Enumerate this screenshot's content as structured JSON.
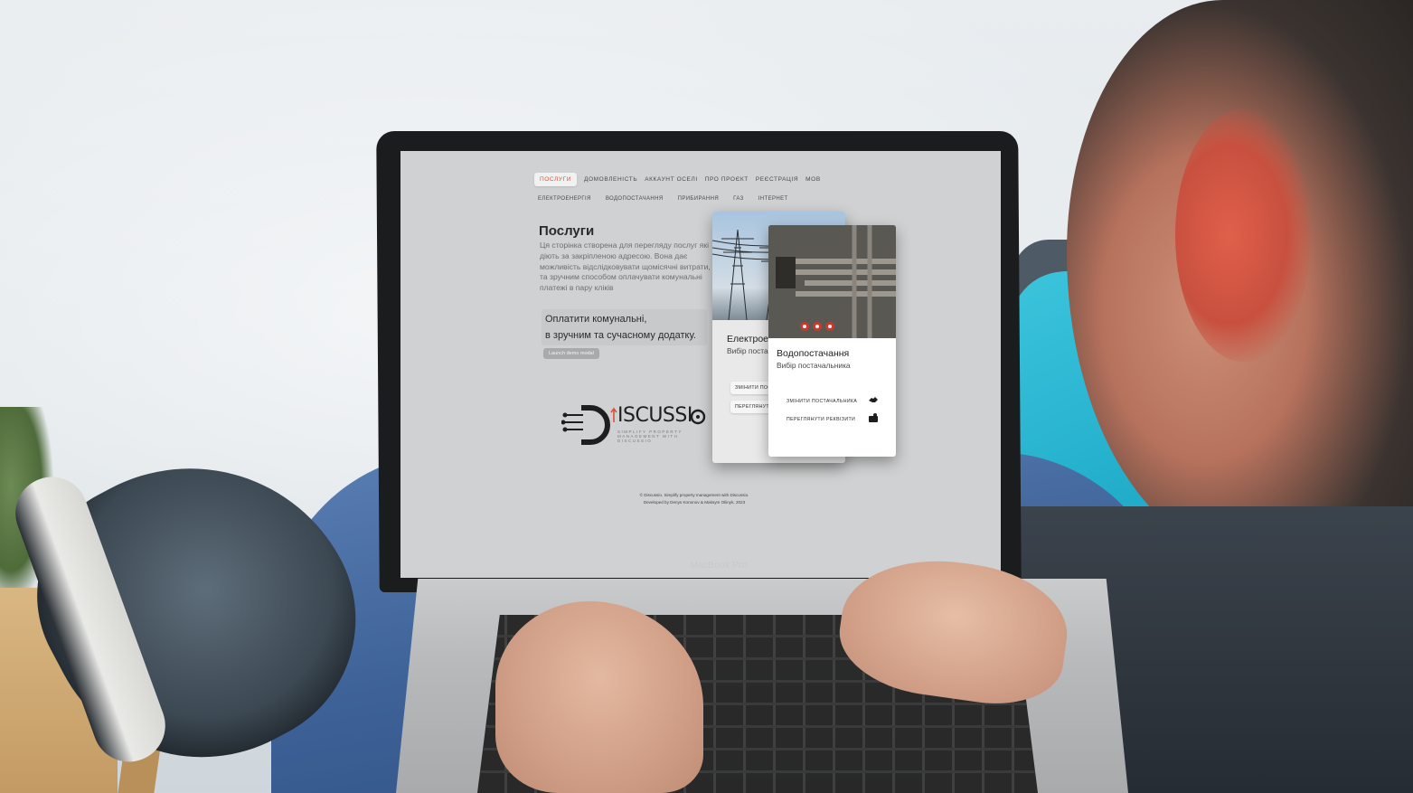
{
  "nav": {
    "items": [
      {
        "label": "ПОСЛУГИ",
        "active": true
      },
      {
        "label": "ДОМОВЛЕНІСТЬ",
        "active": false
      },
      {
        "label": "АККАУНТ ОСЕЛІ",
        "active": false
      },
      {
        "label": "ПРО ПРОЄКТ",
        "active": false
      },
      {
        "label": "РЕЄСТРАЦІЯ",
        "active": false
      },
      {
        "label": "МОВ",
        "active": false
      }
    ],
    "accent_color": "#d9533b"
  },
  "subnav": {
    "items": [
      "ЕЛЕКТРОЕНЕРГІЯ",
      "ВОДОПОСТАЧАННЯ",
      "ПРИБИРАННЯ",
      "ГАЗ",
      "ІНТЕРНЕТ"
    ]
  },
  "main": {
    "title": "Послуги",
    "description": "Ця сторінка створена для перегляду послуг які діють за закріпленою адресою. Вона дає можливість відслідковувати щомісячні витрати, та зручним способом оплачувати комунальні платежі в пару кліків",
    "promo_line1": "Оплатити комунальні,",
    "promo_line2": "в зручним та сучасному додатку.",
    "demo_button": "Launch demo modal"
  },
  "logo": {
    "text": "ISCUSSI",
    "tagline": "SIMPLIFY PROPERTY MANAGEMENT WITH DISCUSSIO"
  },
  "cards": {
    "electricity": {
      "title": "Електроенергія",
      "subtitle": "Вибір постачальника",
      "change_link": "ЗМІНИТИ ПОСТАЧАЛЬНИКА",
      "details_link": "ПЕРЕГЛЯНУТИ РЕКВІЗИТИ"
    },
    "water": {
      "title": "Водопостачання",
      "subtitle": "Вибір постачальника",
      "change_link": "ЗМІНИТИ ПОСТАЧАЛЬНИКА",
      "details_link": "ПЕРЕГЛЯНУТИ РЕКВІЗИТИ",
      "change_icon": "handshake-icon",
      "details_icon": "bank-card-icon"
    }
  },
  "footer": {
    "line1": "© Discussio. Simplify property management with Discussio.",
    "line2": "Developed by Denys Kononov & Maksym Oliinyk, 2023"
  },
  "device": {
    "label": "MacBook Pro"
  }
}
